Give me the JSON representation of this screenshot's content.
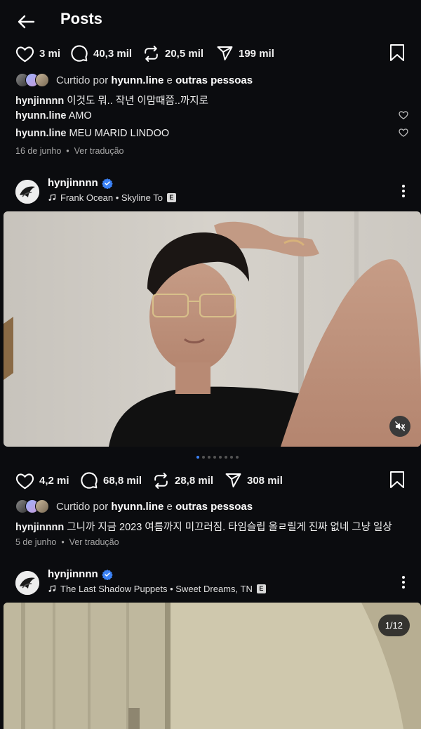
{
  "header": {
    "title": "Posts"
  },
  "post1": {
    "likes": "3 mi",
    "comments": "40,3 mil",
    "reposts": "20,5 mil",
    "shares": "199 mil",
    "liked_prefix": "Curtido por",
    "liked_user": "hyunn.line",
    "liked_mid": "e",
    "liked_others": "outras pessoas",
    "caption_user": "hynjinnnn",
    "caption_text": "이것도 뭐.. 작년 이맘때쯤..까지로",
    "comments_list": [
      {
        "user": "hyunn.line",
        "text": "AMO"
      },
      {
        "user": "hyunn.line",
        "text": "MEU MARID LINDOO"
      }
    ],
    "date": "16 de junho",
    "translate": "Ver tradução"
  },
  "post2": {
    "author": "hynjinnnn",
    "music": "Frank Ocean • Skyline To",
    "explicit": "E",
    "likes": "4,2 mi",
    "comments": "68,8 mil",
    "reposts": "28,8 mil",
    "shares": "308 mil",
    "liked_prefix": "Curtido por",
    "liked_user": "hyunn.line",
    "liked_mid": "e",
    "liked_others": "outras pessoas",
    "caption_user": "hynjinnnn",
    "caption_text": "그니까 지금 2023 여름까지 미끄러짐. 타임슬립 올ㄹ릴게 진짜 없네 그냥 일상",
    "date": "5 de junho",
    "translate": "Ver tradução"
  },
  "post3": {
    "author": "hynjinnnn",
    "music": "The Last Shadow Puppets • Sweet Dreams, TN",
    "explicit": "E",
    "counter": "1/12"
  },
  "colors": {
    "verified": "#3b82f6",
    "background": "#0b0c0f",
    "dot_active": "#3b82f6"
  },
  "icons": [
    "back-arrow-icon",
    "heart-icon",
    "comment-icon",
    "repost-icon",
    "share-icon",
    "bookmark-icon",
    "verified-icon",
    "music-note-icon",
    "more-icon",
    "mute-icon"
  ]
}
